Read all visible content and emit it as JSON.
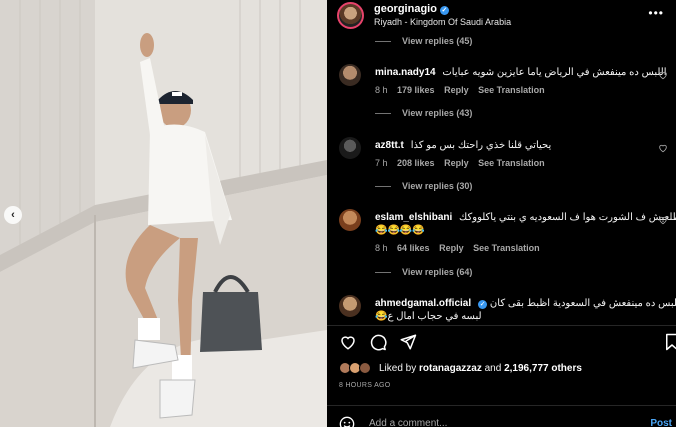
{
  "post": {
    "username": "georginagio",
    "location": "Riyadh - Kingdom Of Saudi Arabia",
    "more_label": "•••",
    "prev_label": "‹"
  },
  "comments": {
    "top_view_replies": "View replies (45)",
    "items": [
      {
        "username": "mina.nady14",
        "text": "اللبس ده مينفعش في الرياض ياما عايزين شويه عبايات",
        "time": "8 h",
        "likes": "179 likes",
        "reply": "Reply",
        "translate": "See Translation",
        "view_replies": "View replies (43)"
      },
      {
        "username": "az8tt.t",
        "text": "يحياتي قلنا خذي راحتك بس مو كذا",
        "time": "7 h",
        "likes": "208 likes",
        "reply": "Reply",
        "translate": "See Translation",
        "view_replies": "View replies (30)"
      },
      {
        "username": "eslam_elshibani",
        "text": "متطلعيش ف الشورت هوا ف السعوديه ي بنتي ياكلووكك",
        "text2": "😂😂😂😂",
        "time": "8 h",
        "likes": "64 likes",
        "reply": "Reply",
        "translate": "See Translation",
        "view_replies": "View replies (64)"
      },
      {
        "username": "ahmedgamal.official",
        "text": "ياعم اللبس ده مينفعش في السعودية اظبط بقى كان",
        "text2": "😂لبسه في حجاب امال ع"
      }
    ]
  },
  "likes": {
    "prefix": "Liked by",
    "user": "rotanagazzaz",
    "joiner": "and",
    "others": "2,196,777 others"
  },
  "time_ago": "8 HOURS AGO",
  "add_comment": {
    "placeholder": "Add a comment...",
    "post_label": "Post"
  },
  "colors": {
    "background": "#000000",
    "muted": "#a8a8a8",
    "link": "#4ca6f5",
    "verified": "#3897f0"
  }
}
